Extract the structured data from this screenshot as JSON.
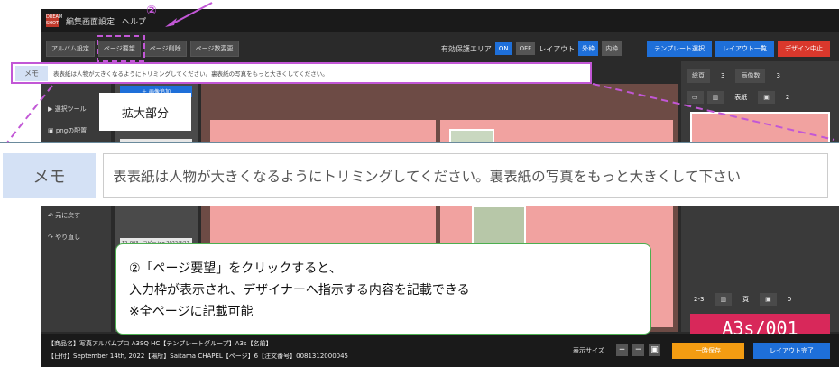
{
  "menubar": {
    "logo": "DREAM SHOT",
    "items": [
      "編集画面設定",
      "ヘルプ"
    ]
  },
  "annotation_number": "②",
  "toolbar": {
    "left_buttons": [
      "アルバム設定",
      "ページ要望",
      "ページ削除",
      "ページ数変更"
    ],
    "safe_area_label": "有効保護エリア",
    "on": "ON",
    "off": "OFF",
    "layout_label": "レイアウト",
    "layout_outside": "外枠",
    "layout_inside": "内枠",
    "template_select": "テンプレート選択",
    "layout_list": "レイアウト一覧",
    "design_cancel": "デザイン中止"
  },
  "memo": {
    "label": "メモ",
    "text": "表表紙は人物が大きくなるようにトリミングしてください。裏表紙の写真をもっと大きくしてください。",
    "text_zoom": "表表紙は人物が大きくなるようにトリミングしてください。裏表紙の写真をもっと大きくして下さい"
  },
  "zoom_label": "拡大部分",
  "left_panel": {
    "items": [
      "選択ツール",
      "pngの配置",
      "元に戻す",
      "やり直し"
    ],
    "add_image": "＋ 画像追加",
    "thumb_caption": "12_003 - コピー.jpg\n2022/3/17 10:24:45"
  },
  "right_panel": {
    "total_pages_label": "総頁",
    "total_pages": "3",
    "image_count_label": "画像数",
    "image_count": "3",
    "cover_label": "表紙",
    "cover_count": "2",
    "spread_label": "2-3",
    "spread_type": "頁",
    "spread_count": "0",
    "stamp": "A3s/001"
  },
  "status": {
    "line1": "【商品名】写真アルバムプロ A3SQ HC【テンプレートグループ】A3s【名前】",
    "line2": "【日付】September 14th, 2022【場所】Saitama CHAPEL【ページ】6【注文番号】0081312000045",
    "zoom_label": "表示サイズ",
    "save": "一時保存",
    "done": "レイアウト完了"
  },
  "callout": {
    "line1": "②「ページ要望」をクリックすると、",
    "line2": "入力枠が表示され、デザイナーへ指示する内容を記載できる",
    "line3": "※全ページに記載可能"
  },
  "colors": {
    "accent_pink": "#c257d6",
    "blue": "#1e6fd9",
    "red": "#d9382c",
    "orange": "#f39c12",
    "page_pink": "#f1a2a0"
  }
}
